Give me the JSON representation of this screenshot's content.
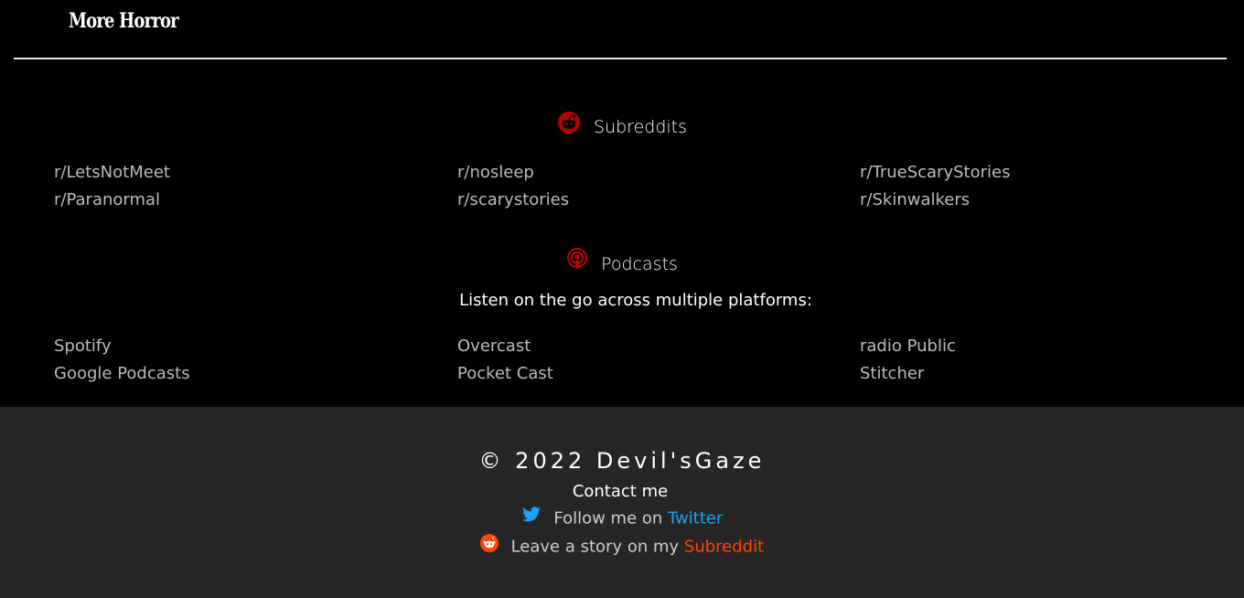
{
  "header": {
    "title": "More Horror"
  },
  "subreddits": {
    "title": "Subreddits",
    "icon": "reddit-icon",
    "links": [
      "r/LetsNotMeet",
      "r/nosleep",
      "r/TrueScaryStories",
      "r/Paranormal",
      "r/scarystories",
      "r/Skinwalkers"
    ]
  },
  "podcasts": {
    "title": "Podcasts",
    "icon": "podcast-icon",
    "tagline": "Listen on the go across multiple platforms:",
    "links": [
      "Spotify",
      "Overcast",
      "radio Public",
      "Google Podcasts",
      "Pocket Cast",
      "Stitcher"
    ]
  },
  "footer": {
    "copyright": "© 2022 Devil'sGaze",
    "contact": "Contact me",
    "twitter_prefix": "Follow me on",
    "twitter_link": "Twitter",
    "reddit_prefix": "Leave a story on my",
    "reddit_link": "Subreddit"
  },
  "colors": {
    "twitter": "#1da1f2",
    "reddit": "#ff4500",
    "section_icon": "#c00000"
  }
}
